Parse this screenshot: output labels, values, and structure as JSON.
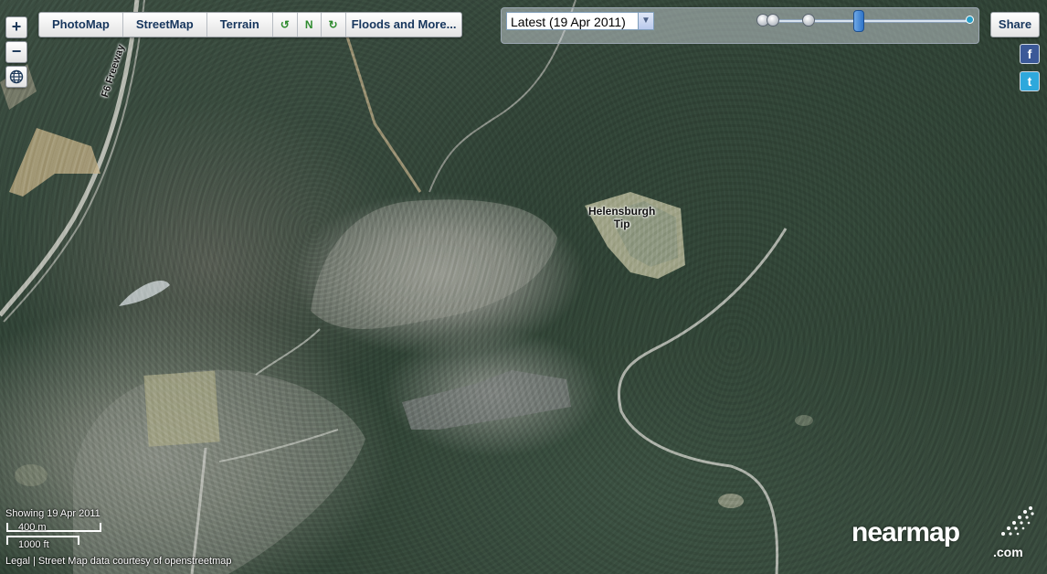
{
  "toolbar": {
    "photomap": "PhotoMap",
    "streetmap": "StreetMap",
    "terrain": "Terrain",
    "rotate_left": "↺",
    "north": "N",
    "rotate_right": "↻",
    "floods": "Floods and More..."
  },
  "zoom": {
    "zoom_in": "+",
    "zoom_out": "−",
    "globe": "globe-icon"
  },
  "timeline": {
    "selected_date": "Latest (19 Apr 2011)",
    "selected_fraction": 0.47
  },
  "share": {
    "label": "Share"
  },
  "social": {
    "facebook": "f",
    "twitter": "t"
  },
  "map_labels": {
    "freeway": "F6 Freeway",
    "tip_line1": "Helensburgh",
    "tip_line2": "Tip"
  },
  "status": {
    "showing": "Showing 19 Apr 2011",
    "scale_metric": "400 m",
    "scale_imperial": "1000 ft",
    "legal": "Legal",
    "separator": "|",
    "attribution": "Street Map data courtesy of openstreetmap"
  },
  "logo": {
    "name": "nearmap",
    "domain": ".com"
  },
  "colors": {
    "button_text": "#17365d",
    "accent_green": "#2e8b2e",
    "thumb": "#2e74c8"
  }
}
